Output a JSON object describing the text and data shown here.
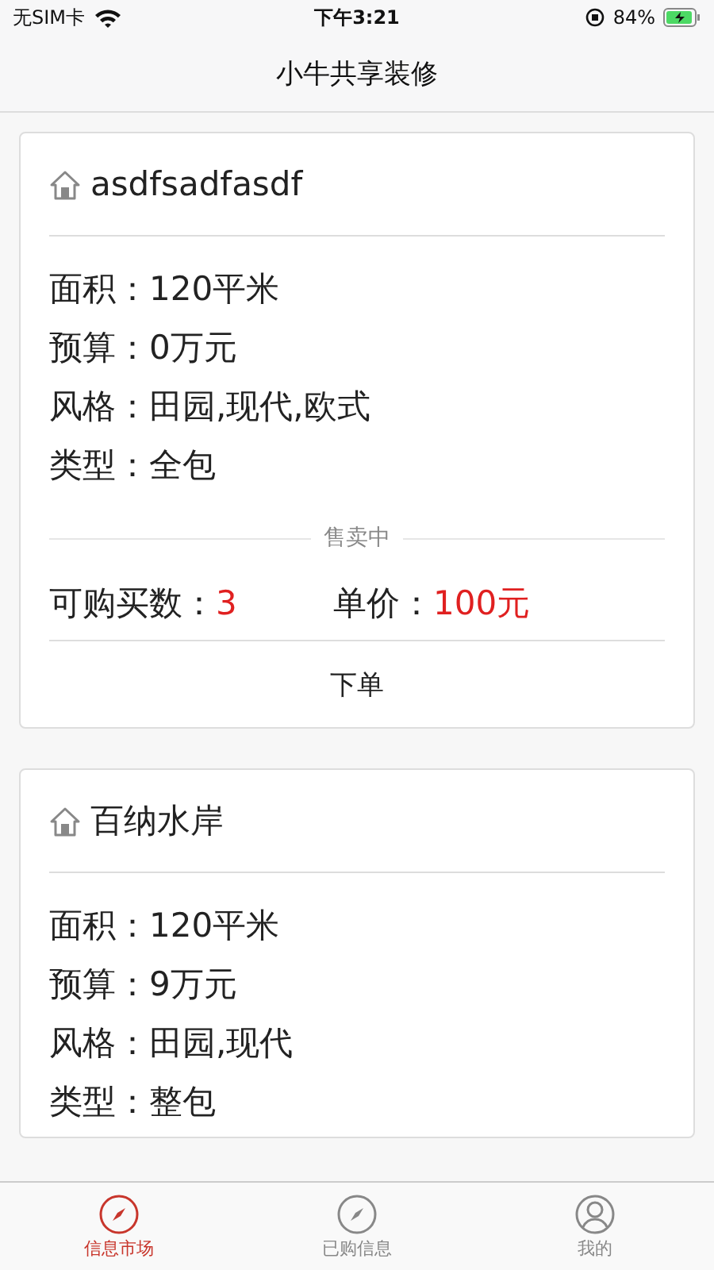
{
  "status_bar": {
    "carrier": "无SIM卡",
    "time": "下午3:21",
    "battery": "84%"
  },
  "nav": {
    "title": "小牛共享装修"
  },
  "listings": [
    {
      "title": "asdfsadfasdf",
      "fields": [
        {
          "label": "面积：",
          "value": "120平米"
        },
        {
          "label": "预算：",
          "value": "0万元"
        },
        {
          "label": "风格：",
          "value": "田园,现代,欧式"
        },
        {
          "label": "类型：",
          "value": "全包"
        }
      ],
      "status": "售卖中",
      "quantity_label": "可购买数：",
      "quantity": "3",
      "price_label": "单价：",
      "price": "100元",
      "action": "下单"
    },
    {
      "title": "百纳水岸",
      "fields": [
        {
          "label": "面积：",
          "value": "120平米"
        },
        {
          "label": "预算：",
          "value": "9万元"
        },
        {
          "label": "风格：",
          "value": "田园,现代"
        },
        {
          "label": "类型：",
          "value": "整包"
        }
      ]
    }
  ],
  "tabs": [
    {
      "label": "信息市场",
      "kind": "compass",
      "selected": true
    },
    {
      "label": "已购信息",
      "kind": "compass",
      "selected": false
    },
    {
      "label": "我的",
      "kind": "person",
      "selected": false
    }
  ]
}
